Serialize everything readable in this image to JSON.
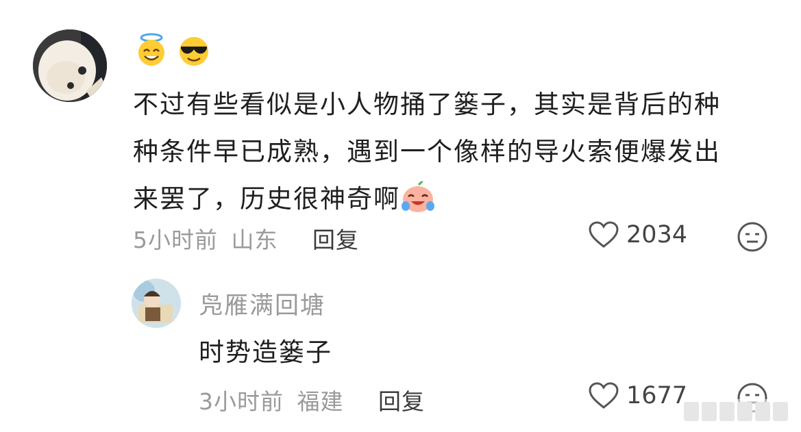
{
  "comment": {
    "emojis": [
      "halo-smile-emoji",
      "sunglasses-emoji"
    ],
    "text_line1": "不过有些看似是小人物捅了篓子，其实是背后的种",
    "text_line2": "种条件早已成熟，遇到一个像样的导火索便爆发出",
    "text_line3": "来罢了，历史很神奇啊",
    "inline_emoji": "laugh-cry-emoji",
    "time": "5小时前",
    "location": "山东",
    "reply_label": "回复",
    "likes": "2034"
  },
  "reply": {
    "username": "凫雁满回塘",
    "text": "时势造篓子",
    "time": "3小时前",
    "location": "福建",
    "reply_label": "回复",
    "likes": "1677"
  },
  "colors": {
    "text_primary": "#1f1f1f",
    "text_meta": "#9a9a9a",
    "icon_gray": "#444444",
    "background": "#ffffff"
  }
}
